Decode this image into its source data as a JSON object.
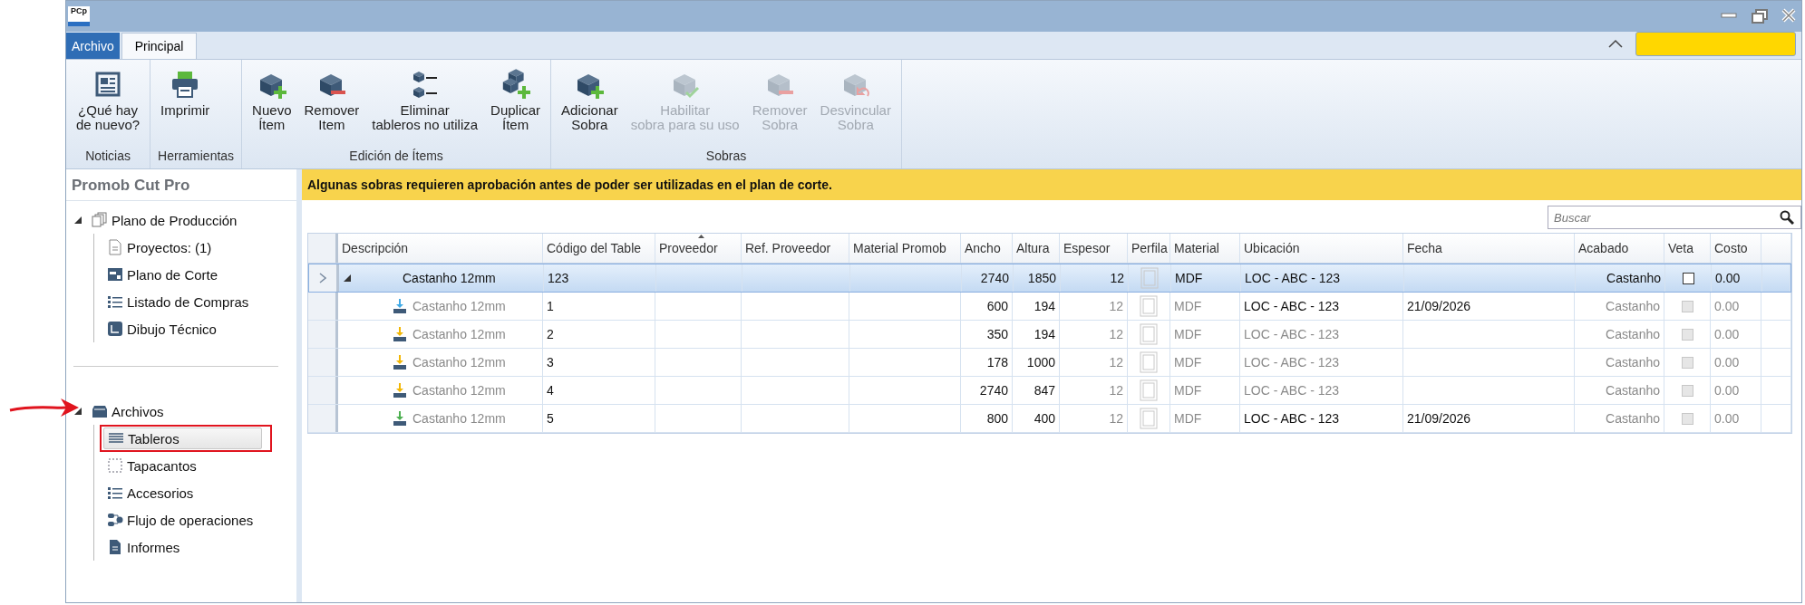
{
  "window": {
    "app_icon_text": "PCp"
  },
  "ribbon": {
    "tabs": [
      {
        "label": "Archivo",
        "kind": "file",
        "selected": false
      },
      {
        "label": "Principal",
        "kind": "page",
        "selected": true
      }
    ],
    "groups": [
      {
        "label": "Noticias",
        "buttons": [
          {
            "label": "¿Qué hay\nde nuevo?",
            "disabled": false
          }
        ]
      },
      {
        "label": "Herramientas",
        "buttons": [
          {
            "label": "Imprimir",
            "disabled": false
          }
        ]
      },
      {
        "label": "Edición de Ítems",
        "buttons": [
          {
            "label": "Nuevo\nÍtem",
            "disabled": false
          },
          {
            "label": "Remover\nItem",
            "disabled": false
          },
          {
            "label": "Eliminar\ntableros no utiliza",
            "disabled": false
          },
          {
            "label": "Duplicar\nÍtem",
            "disabled": false
          }
        ]
      },
      {
        "label": "Sobras",
        "buttons": [
          {
            "label": "Adicionar\nSobra",
            "disabled": false
          },
          {
            "label": "Habilitar\nsobra para su uso",
            "disabled": true
          },
          {
            "label": "Remover\nSobra",
            "disabled": true
          },
          {
            "label": "Desvincular\nSobra",
            "disabled": true
          }
        ]
      }
    ]
  },
  "sidebar": {
    "title": "Promob Cut Pro",
    "tree": [
      {
        "label": "Plano de Producción",
        "expanded": true,
        "marked": false,
        "children": [
          {
            "label": "Proyectos: (1)",
            "selected": false,
            "marked": false
          },
          {
            "label": "Plano de Corte",
            "selected": false,
            "marked": false
          },
          {
            "label": "Listado de Compras",
            "selected": false,
            "marked": false
          },
          {
            "label": "Dibujo Técnico",
            "selected": false,
            "marked": false
          }
        ]
      },
      {
        "label": "Archivos",
        "expanded": true,
        "marked": true,
        "children": [
          {
            "label": "Tableros",
            "selected": true,
            "marked": true
          },
          {
            "label": "Tapacantos",
            "selected": false,
            "marked": false
          },
          {
            "label": "Accesorios",
            "selected": false,
            "marked": false
          },
          {
            "label": "Flujo de operaciones",
            "selected": false,
            "marked": false
          },
          {
            "label": "Informes",
            "selected": false,
            "marked": false
          }
        ]
      }
    ]
  },
  "banner": {
    "text": "Algunas sobras requieren aprobación antes de poder ser utilizadas en el plan de corte."
  },
  "search": {
    "placeholder": "Buscar"
  },
  "table": {
    "columns": [
      {
        "label": "Descripción",
        "sorted": false
      },
      {
        "label": "Código del Table",
        "sorted": false
      },
      {
        "label": "Proveedor",
        "sorted": true
      },
      {
        "label": "Ref. Proveedor",
        "sorted": false
      },
      {
        "label": "Material Promob",
        "sorted": false
      },
      {
        "label": "Ancho",
        "sorted": false
      },
      {
        "label": "Altura",
        "sorted": false
      },
      {
        "label": "Espesor",
        "sorted": false
      },
      {
        "label": "Perfila",
        "sorted": false
      },
      {
        "label": "Material",
        "sorted": false
      },
      {
        "label": "Ubicación",
        "sorted": false
      },
      {
        "label": "Fecha",
        "sorted": false
      },
      {
        "label": "Acabado",
        "sorted": false
      },
      {
        "label": "Veta",
        "sorted": false
      },
      {
        "label": "Costo",
        "sorted": false
      }
    ],
    "rows": [
      {
        "kind": "group",
        "selected": true,
        "expanded": true,
        "available": true,
        "descripcion": "Castanho 12mm",
        "codigo": "123",
        "ancho": "2740",
        "altura": "1850",
        "espesor": "12",
        "material": "MDF",
        "ubicacion": "LOC - ABC - 123",
        "acabado": "Castanho",
        "veta": {
          "checked": false,
          "disabled": false
        },
        "costo": "0.00"
      },
      {
        "kind": "item",
        "selected": false,
        "color": "#3fa9e6",
        "available": true,
        "descripcion": "Castanho 12mm",
        "codigo": "1",
        "ancho": "600",
        "altura": "194",
        "espesor": "12",
        "material": "MDF",
        "ubicacion": "LOC - ABC - 123",
        "fecha": "21/09/2026",
        "acabado": "Castanho",
        "veta": {
          "checked": false,
          "disabled": true
        },
        "costo": "0.00"
      },
      {
        "kind": "item",
        "selected": false,
        "color": "#f2b705",
        "available": false,
        "descripcion": "Castanho 12mm",
        "codigo": "2",
        "ancho": "350",
        "altura": "194",
        "espesor": "12",
        "material": "MDF",
        "ubicacion": "LOC - ABC - 123",
        "acabado": "Castanho",
        "veta": {
          "checked": false,
          "disabled": true
        },
        "costo": "0.00"
      },
      {
        "kind": "item",
        "selected": false,
        "color": "#f2b705",
        "available": false,
        "descripcion": "Castanho 12mm",
        "codigo": "3",
        "ancho": "178",
        "altura": "1000",
        "espesor": "12",
        "material": "MDF",
        "ubicacion": "LOC - ABC - 123",
        "acabado": "Castanho",
        "veta": {
          "checked": false,
          "disabled": true
        },
        "costo": "0.00"
      },
      {
        "kind": "item",
        "selected": false,
        "color": "#f2b705",
        "available": false,
        "descripcion": "Castanho 12mm",
        "codigo": "4",
        "ancho": "2740",
        "altura": "847",
        "espesor": "12",
        "material": "MDF",
        "ubicacion": "LOC - ABC - 123",
        "acabado": "Castanho",
        "veta": {
          "checked": false,
          "disabled": true
        },
        "costo": "0.00"
      },
      {
        "kind": "item",
        "selected": false,
        "color": "#4caf50",
        "available": true,
        "descripcion": "Castanho 12mm",
        "codigo": "5",
        "ancho": "800",
        "altura": "400",
        "espesor": "12",
        "material": "MDF",
        "ubicacion": "LOC - ABC - 123",
        "fecha": "21/09/2026",
        "acabado": "Castanho",
        "veta": {
          "checked": false,
          "disabled": true
        },
        "costo": "0.00"
      }
    ]
  }
}
